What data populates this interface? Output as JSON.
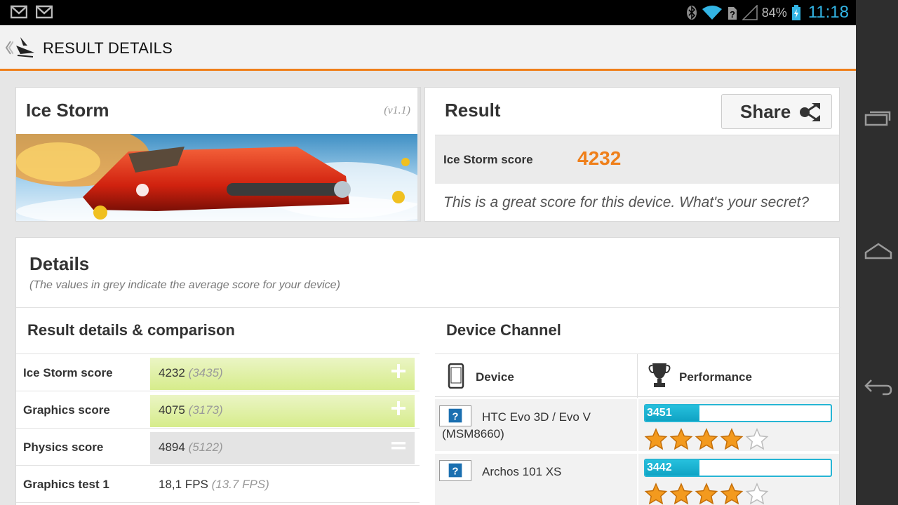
{
  "status_bar": {
    "battery": "84%",
    "time": "11:18"
  },
  "action_bar": {
    "title": "RESULT DETAILS"
  },
  "test_card": {
    "name": "Ice Storm",
    "version": "(v1.1)"
  },
  "result_card": {
    "heading": "Result",
    "share_label": "Share",
    "score_label": "Ice Storm score",
    "score_value": "4232",
    "message": "This is a great score for this device. What's your secret?"
  },
  "details": {
    "heading": "Details",
    "subtitle": "(The values in grey indicate the average score for your device)",
    "comparison_title": "Result details & comparison",
    "channel_title": "Device Channel",
    "comparison_rows": [
      {
        "label": "Ice Storm score",
        "value": "4232",
        "average": "(3435)",
        "indicator": "plus"
      },
      {
        "label": "Graphics score",
        "value": "4075",
        "average": "(3173)",
        "indicator": "plus"
      },
      {
        "label": "Physics score",
        "value": "4894",
        "average": "(5122)",
        "indicator": "equal"
      },
      {
        "label": "Graphics test 1",
        "value": "18,1 FPS",
        "average": "(13.7 FPS)",
        "indicator": "none"
      }
    ],
    "channel": {
      "col_device": "Device",
      "col_performance": "Performance",
      "devices": [
        {
          "name": "HTC Evo 3D / Evo V (MSM8660)",
          "score": "3451",
          "fill": 0.29,
          "stars": 4,
          "max_stars": 5
        },
        {
          "name": "Archos 101 XS",
          "score": "3442",
          "fill": 0.29,
          "stars": 4,
          "max_stars": 5
        }
      ]
    }
  },
  "colors": {
    "accent": "#ef7f1a",
    "perf_bar": "#26b5d4",
    "plus_bar": "#d6ec8b",
    "clock": "#33b5e5"
  }
}
